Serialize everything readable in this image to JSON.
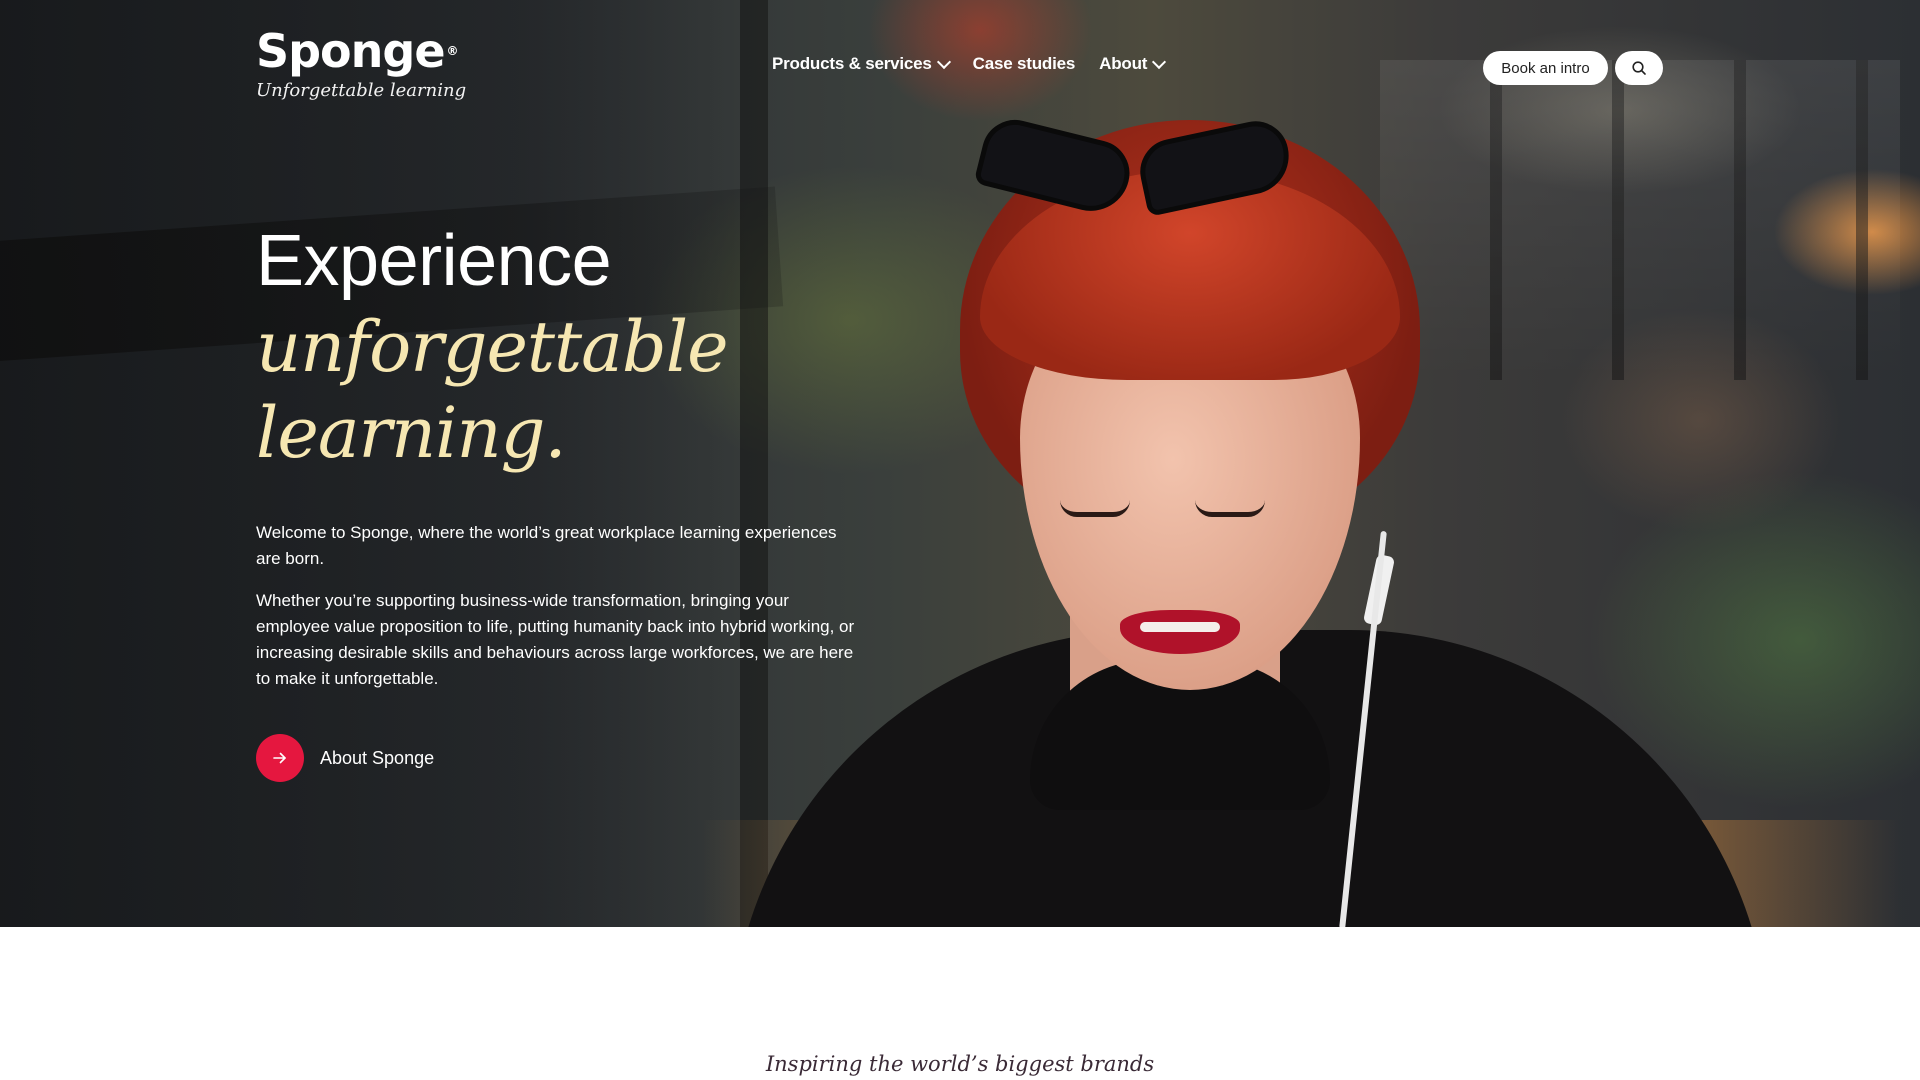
{
  "brand": {
    "name": "Sponge",
    "registered_mark": "®",
    "tagline": "Unforgettable learning"
  },
  "nav": {
    "items": [
      {
        "label": "Products & services",
        "has_dropdown": true
      },
      {
        "label": "Case studies",
        "has_dropdown": false
      },
      {
        "label": "About",
        "has_dropdown": true
      }
    ],
    "cta_label": "Book an intro",
    "search_icon": "search-icon"
  },
  "hero": {
    "headline_line1": "Experience",
    "headline_line2": "unforgettable",
    "headline_line3": "learning.",
    "intro": "Welcome to Sponge, where the world’s great workplace learning experiences are born.",
    "body": "Whether you’re supporting business-wide transformation, bringing your employee value proposition to life, putting humanity back into hybrid working, or increasing desirable skills and behaviours across large workforces, we are here to make it unforgettable.",
    "link_label": "About Sponge",
    "link_icon": "arrow-right-icon"
  },
  "brands_section": {
    "tagline": "Inspiring the world’s biggest brands"
  },
  "colors": {
    "accent_red": "#e5173f",
    "headline_cream": "#f6e7b2",
    "text_white": "#ffffff"
  }
}
